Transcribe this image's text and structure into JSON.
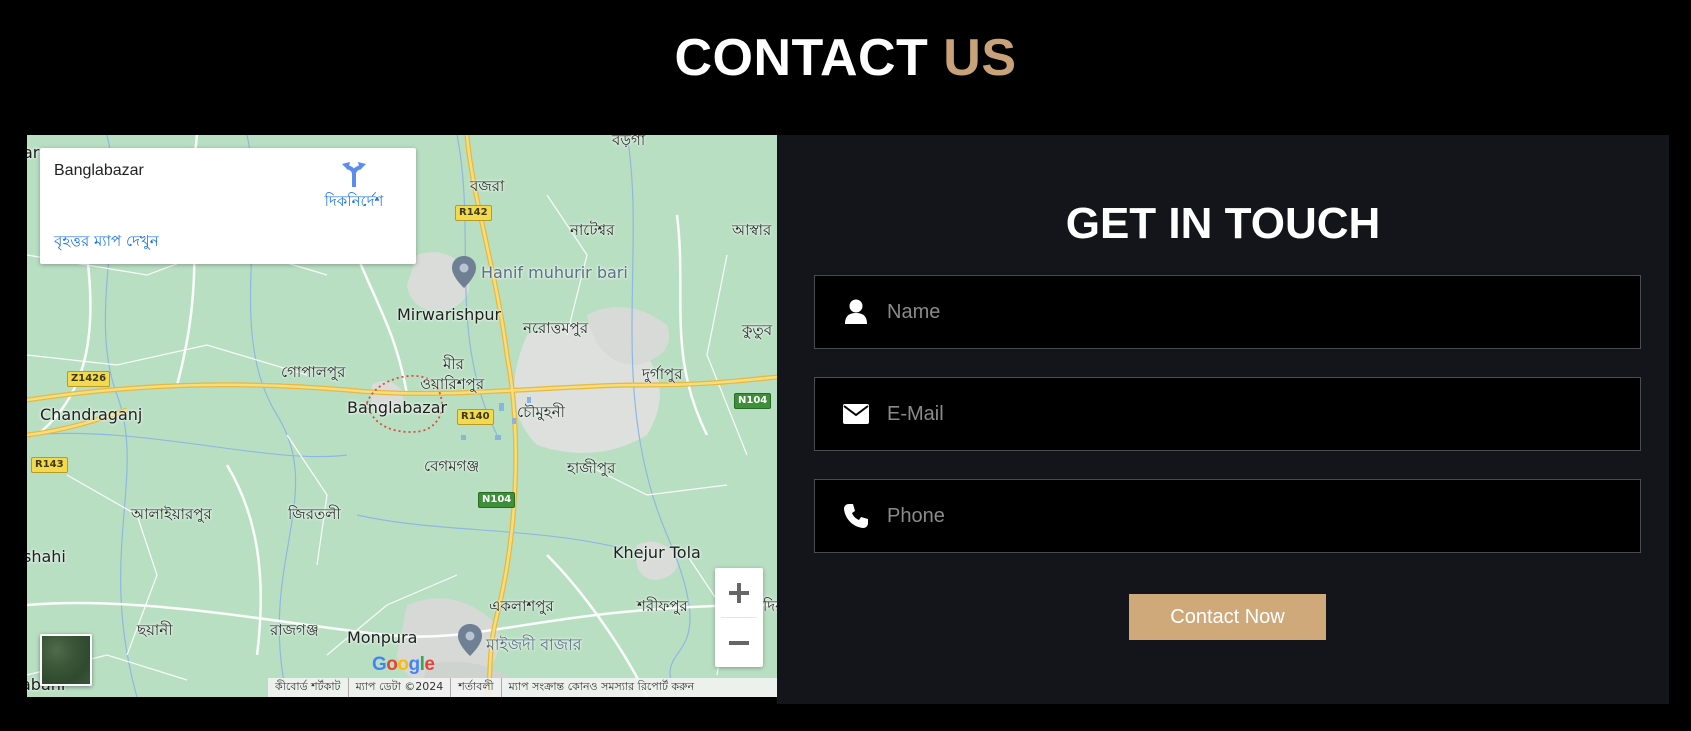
{
  "header": {
    "title_main": "CONTACT",
    "title_accent": "US",
    "accent_color": "#c9a27a"
  },
  "map": {
    "card": {
      "place_name": "Banglabazar",
      "directions_label": "দিকনির্দেশ",
      "larger_map_label": "বৃহত্তর ম্যাপ দেখুন",
      "directions_icon": "directions-icon"
    },
    "labels": {
      "bargo": "বড়গা",
      "bojra": "বজরা",
      "nateshwar": "নাটেশ্বর",
      "aswar": "আস্বার",
      "hanif": "Hanif muhurir bari",
      "mirwarishpur": "Mirwarishpur",
      "narottampur": "নরোত্তমপুর",
      "kutub": "কুতুব",
      "gopalpur": "গোপালপুর",
      "mir": "মীর",
      "oyarishpur": "ওয়ারিশপুর",
      "durgapur": "দুর্গাপুর",
      "chandraganj": "Chandraganj",
      "banglabazar": "Banglabazar",
      "chowmuhani": "চৌমুহনী",
      "begomganj": "বেগমগঞ্জ",
      "hajipur": "হাজীপুর",
      "alaiarpur": "আলাইয়ারপুর",
      "jirtoli": "জিরতলী",
      "shahi": "shahi",
      "khejur": "Khejur Tola",
      "eklashpur": "একলাশপুর",
      "sharifpur": "শরীফপুর",
      "dir": "দির",
      "chhayani": "ছয়ানী",
      "rajganj": "রাজগঞ্জ",
      "monpura": "Monpura",
      "maijdi": "মাইজদী বাজার",
      "abani": "abani",
      "ar": "ar"
    },
    "shields": {
      "r142": "R142",
      "z1426": "Z1426",
      "r140": "R140",
      "n104a": "N104",
      "r143": "R143",
      "n104b": "N104"
    },
    "zoom_in_icon": "plus-icon",
    "zoom_out_icon": "minus-icon",
    "google_logo": {
      "G": "G",
      "o1": "o",
      "o2": "o",
      "g": "g",
      "l": "l",
      "e": "e"
    },
    "attribution": {
      "shortcuts": "কীবোর্ড শর্টকাট",
      "map_data": "ম্যাপ ডেটা ©2024",
      "terms": "শর্তাবলী",
      "report": "ম্যাপ সংক্রান্ত কোনও সমস্যার রিপোর্ট করুন"
    }
  },
  "form": {
    "title": "GET IN TOUCH",
    "name_placeholder": "Name",
    "email_placeholder": "E-Mail",
    "phone_placeholder": "Phone",
    "name_icon": "user-icon",
    "email_icon": "envelope-icon",
    "phone_icon": "phone-icon",
    "submit_label": "Contact Now",
    "button_color": "#d0a97b",
    "panel_color": "#13151a"
  }
}
